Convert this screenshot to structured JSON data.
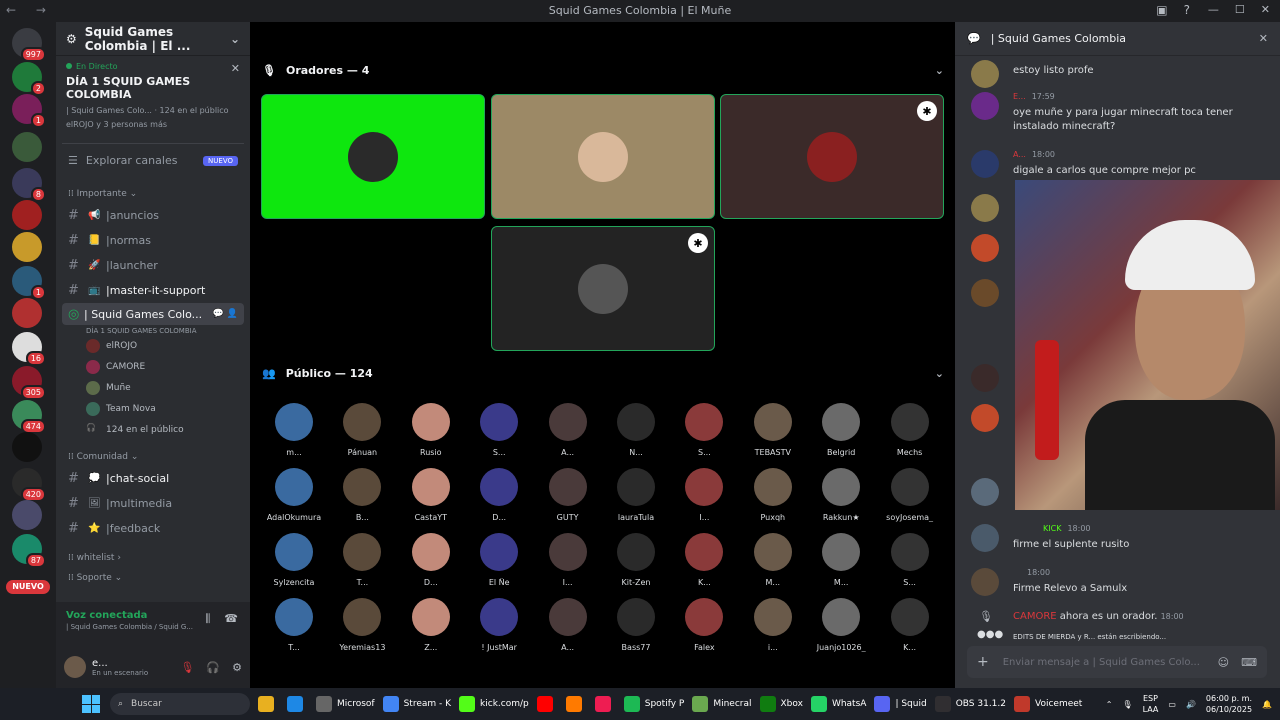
{
  "window": {
    "title": "Squid Games Colombia | El Muñe"
  },
  "guilds": [
    {
      "name": "server-1",
      "badge": "997",
      "color": "#3a3c42"
    },
    {
      "name": "server-2",
      "badge": "2",
      "color": "#1f7a3a"
    },
    {
      "name": "server-3",
      "badge": "1",
      "color": "#7a1f5a"
    },
    {
      "name": "server-4",
      "badge": "",
      "color": "#3a5a3a"
    },
    {
      "name": "server-5",
      "badge": "8",
      "color": "#3a3a5a"
    },
    {
      "name": "server-6",
      "badge": "",
      "color": "#a02020"
    },
    {
      "name": "server-7",
      "badge": "",
      "color": "#c89a2a"
    },
    {
      "name": "server-8",
      "badge": "1",
      "color": "#2a5a7a"
    },
    {
      "name": "server-9",
      "badge": "",
      "color": "#b03030"
    },
    {
      "name": "server-10",
      "badge": "16",
      "color": "#ddd"
    },
    {
      "name": "server-11",
      "badge": "305",
      "color": "#8a1a2a"
    },
    {
      "name": "server-12",
      "badge": "474",
      "color": "#3a8a5a"
    },
    {
      "name": "server-13",
      "badge": "",
      "color": "#111"
    },
    {
      "name": "server-14",
      "badge": "420",
      "color": "#2a2a2a"
    },
    {
      "name": "server-15",
      "badge": "",
      "color": "#4a4a6a"
    },
    {
      "name": "server-16",
      "badge": "87",
      "color": "#1a8a6a"
    }
  ],
  "nuevo_label": "NUEVO",
  "sidebar": {
    "server_name": "Squid Games Colombia | El ...",
    "live_label": "En Directo",
    "event_title": "DÍA 1 SQUID GAMES COLOMBIA",
    "event_sub": "| Squid Games Colo... · 124 en el público",
    "event_who": "elROJO y 3 personas más",
    "explore_label": "Explorar canales",
    "new_badge": "NUEVO",
    "cat_importante": "Importante",
    "cat_comunidad": "Comunidad",
    "cat_whitelist": "whitelist",
    "cat_soporte": "Soporte",
    "channels_imp": [
      {
        "label": "anuncios",
        "emoji": "📢",
        "bold": false
      },
      {
        "label": "normas",
        "emoji": "📒",
        "bold": false
      },
      {
        "label": "launcher",
        "emoji": "🚀",
        "bold": false
      },
      {
        "label": "master-it-support",
        "emoji": "📺",
        "bold": true
      }
    ],
    "active_channel": "| Squid Games Colo...",
    "active_sub": "DÍA 1 SQUID GAMES COLOMBIA",
    "voice_members": [
      "elROJO",
      "CAMORE",
      "Muñe",
      "Team Nova",
      "124 en el público"
    ],
    "channels_com": [
      {
        "label": "chat-social",
        "emoji": "💭",
        "bold": true
      },
      {
        "label": "multimedia",
        "emoji": "🖼",
        "bold": false
      },
      {
        "label": "feedback",
        "emoji": "⭐",
        "bold": false
      }
    ],
    "voice_connected": "Voz conectada",
    "voice_sub": "| Squid Games Colombia / Squid G...",
    "user_name": "e...",
    "user_status": "En un escenario"
  },
  "stage": {
    "speakers_label": "Oradores — 4",
    "audience_label": "Público — 124",
    "audience": [
      "m...",
      "Pánuan",
      "Rusio",
      "S...",
      "A...",
      "N...",
      "S...",
      "TEBASTV",
      "Belgrid",
      "Mechs",
      "AdalOkumura",
      "B...",
      "CastaYT",
      "D...",
      "GUTY",
      "lauraTula",
      "I...",
      "Puxqh",
      "Rakkun★",
      "soyJosema_",
      "Sylzencita",
      "T...",
      "D...",
      "El Ñe",
      "I...",
      "Kit-Zen",
      "K...",
      "M...",
      "M...",
      "S...",
      "T...",
      "Yeremias13",
      "Z...",
      "! JustMar",
      "A...",
      "Bass77",
      "Falex",
      "i...",
      "Juanjo1026_",
      "K..."
    ]
  },
  "chat": {
    "header": "| Squid Games Colombia",
    "messages": [
      {
        "name": "",
        "time": "",
        "text": "estoy listo profe"
      },
      {
        "name": "E...",
        "time": "17:59",
        "text": "oye muñe y para jugar minecraft toca tener instalado minecraft?"
      },
      {
        "name": "A...",
        "time": "18:00",
        "text": "digale a carlos que compre mejor pc"
      },
      {
        "name": "",
        "time": "18:00",
        "text": "firme el suplente rusito",
        "tag": "KICK"
      },
      {
        "name": "",
        "time": "18:00",
        "text": "Firme Relevo a Samulx"
      }
    ],
    "system_name": "CAMORE",
    "system_text": "ahora es un orador.",
    "system_time": "18:00",
    "typing": "EDITS DE MIERDA y R... están escribiendo...",
    "input_placeholder": "Enviar mensaje a | Squid Games Colo..."
  },
  "taskbar": {
    "search": "Buscar",
    "apps": [
      {
        "label": "",
        "color": "#e8b020"
      },
      {
        "label": "",
        "color": "#1e88e5"
      },
      {
        "label": "Microsof",
        "color": "#666"
      },
      {
        "label": "Stream - K",
        "color": "#4285f4"
      },
      {
        "label": "kick.com/p",
        "color": "#53fc18"
      },
      {
        "label": "",
        "color": "#ff0000"
      },
      {
        "label": "",
        "color": "#ff7a00"
      },
      {
        "label": "",
        "color": "#ee1d52"
      },
      {
        "label": "Spotify P",
        "color": "#1db954"
      },
      {
        "label": "Minecral",
        "color": "#6aa84f"
      },
      {
        "label": "Xbox",
        "color": "#107c10"
      },
      {
        "label": "WhatsA",
        "color": "#25d366"
      },
      {
        "label": "| Squid",
        "color": "#5865f2"
      },
      {
        "label": "OBS 31.1.2",
        "color": "#302e31"
      },
      {
        "label": "Voicemeet",
        "color": "#c0392b"
      }
    ],
    "lang1": "ESP",
    "lang2": "LAA",
    "time": "06:00 p. m.",
    "date": "06/10/2025"
  }
}
